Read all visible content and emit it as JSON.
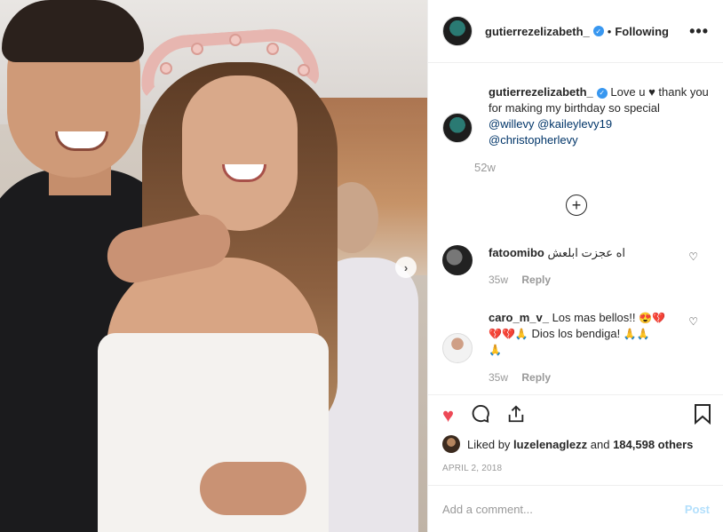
{
  "header": {
    "username": "gutierrezelizabeth_",
    "separator": "•",
    "follow_label": "Following",
    "more_icon": "more-horizontal-icon"
  },
  "caption": {
    "username": "gutierrezelizabeth_",
    "text_start": "Love u",
    "heart": "♥",
    "text_end": "thank you for making my birthday so special",
    "mentions": [
      "@willevy",
      "@kaileylevy19",
      "@christopherlevy"
    ],
    "time": "52w"
  },
  "load_more_icon": "plus-circle-icon",
  "comments": [
    {
      "username": "fatoomibo",
      "text": "اه عجزت ابلعش",
      "time": "35w",
      "reply_label": "Reply"
    },
    {
      "username": "caro_m_v_",
      "text_a": "Los mas bellos!!",
      "emoji_a": "😍💔",
      "emoji_b": "💔💔🙏",
      "text_b": "Dios los bendiga!",
      "emoji_c": "🙏🙏",
      "emoji_d": "🙏",
      "time": "35w",
      "reply_label": "Reply"
    }
  ],
  "likes": {
    "prefix": "Liked by",
    "user": "luzelenaglezz",
    "conj": "and",
    "others": "184,598 others"
  },
  "date": "APRIL 2, 2018",
  "add_comment": {
    "placeholder": "Add a comment...",
    "post_label": "Post"
  },
  "colors": {
    "like_red": "#ed4956",
    "mention_blue": "#003569",
    "verified_blue": "#3897f0",
    "post_disabled": "#b2dffc"
  }
}
